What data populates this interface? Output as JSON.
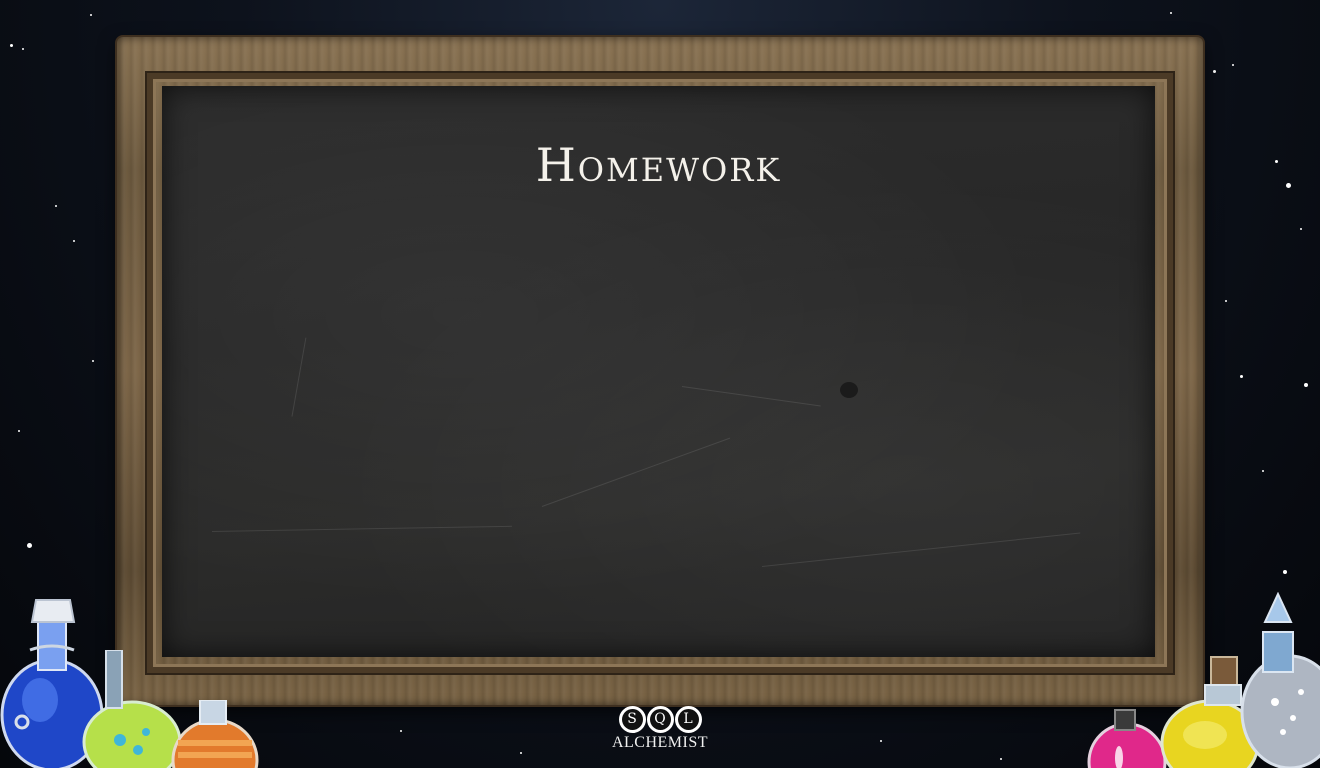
{
  "board": {
    "title": "Homework"
  },
  "logo": {
    "letters": [
      "S",
      "Q",
      "L"
    ],
    "text": "ALCHEMIST"
  },
  "colors": {
    "chalkboard": "#2a2a2a",
    "frame_wood": "#7a6445",
    "background": "#0d121c"
  },
  "icons": {
    "left_bottles": [
      "blue-potion-bottle-icon",
      "green-potion-bottle-icon",
      "orange-potion-bottle-icon"
    ],
    "right_bottles": [
      "pink-potion-bottle-icon",
      "yellow-potion-bottle-icon",
      "silver-potion-bottle-icon"
    ]
  }
}
